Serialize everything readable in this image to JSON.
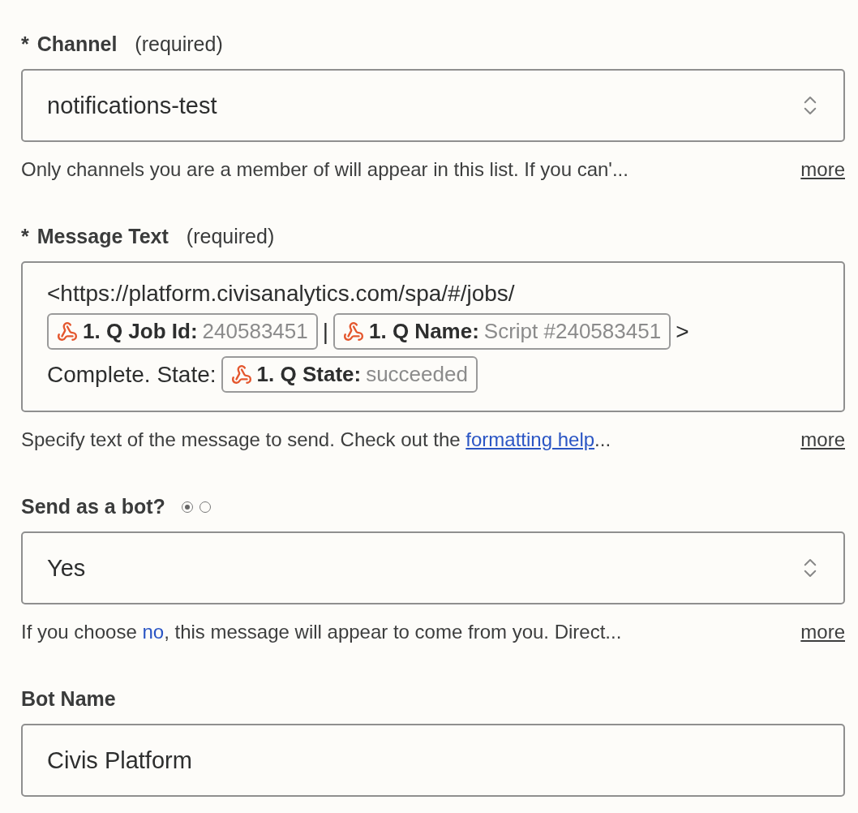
{
  "fields": [
    {
      "kind": "select",
      "marker": "*",
      "label": "Channel",
      "note": "(required)",
      "value": "notifications-test",
      "help": [
        {
          "kind": "plain",
          "text": "Only channels you are a member of will appear in this list. If you can'..."
        }
      ],
      "more": "more"
    },
    {
      "kind": "message",
      "marker": "*",
      "label": "Message Text",
      "note": "(required)",
      "lines": [
        [
          {
            "kind": "text",
            "text": "<https://platform.civisanalytics.com/spa/#/jobs/"
          }
        ],
        [
          {
            "kind": "pill",
            "name": "1. Q Job Id:",
            "value": "240583451"
          },
          {
            "kind": "text",
            "text": "|"
          },
          {
            "kind": "pill",
            "name": "1. Q Name:",
            "value": "Script #240583451"
          },
          {
            "kind": "text",
            "text": ">"
          }
        ],
        [
          {
            "kind": "text",
            "text": "Complete. State:"
          },
          {
            "kind": "pill",
            "name": "1. Q State:",
            "value": "succeeded"
          }
        ]
      ],
      "help": [
        {
          "kind": "plain",
          "text": "Specify text of the message to send. Check out the "
        },
        {
          "kind": "link",
          "text": "formatting help"
        },
        {
          "kind": "plain",
          "text": "..."
        }
      ],
      "more": "more"
    },
    {
      "kind": "select",
      "label": "Send as a bot?",
      "radios": [
        {
          "selected": true
        },
        {
          "selected": false
        }
      ],
      "value": "Yes",
      "help": [
        {
          "kind": "plain",
          "text": "If you choose "
        },
        {
          "kind": "accent",
          "text": "no"
        },
        {
          "kind": "plain",
          "text": ", this message will appear to come from you. Direct..."
        }
      ],
      "more": "more"
    },
    {
      "kind": "text",
      "label": "Bot Name",
      "value": "Civis Platform"
    }
  ]
}
